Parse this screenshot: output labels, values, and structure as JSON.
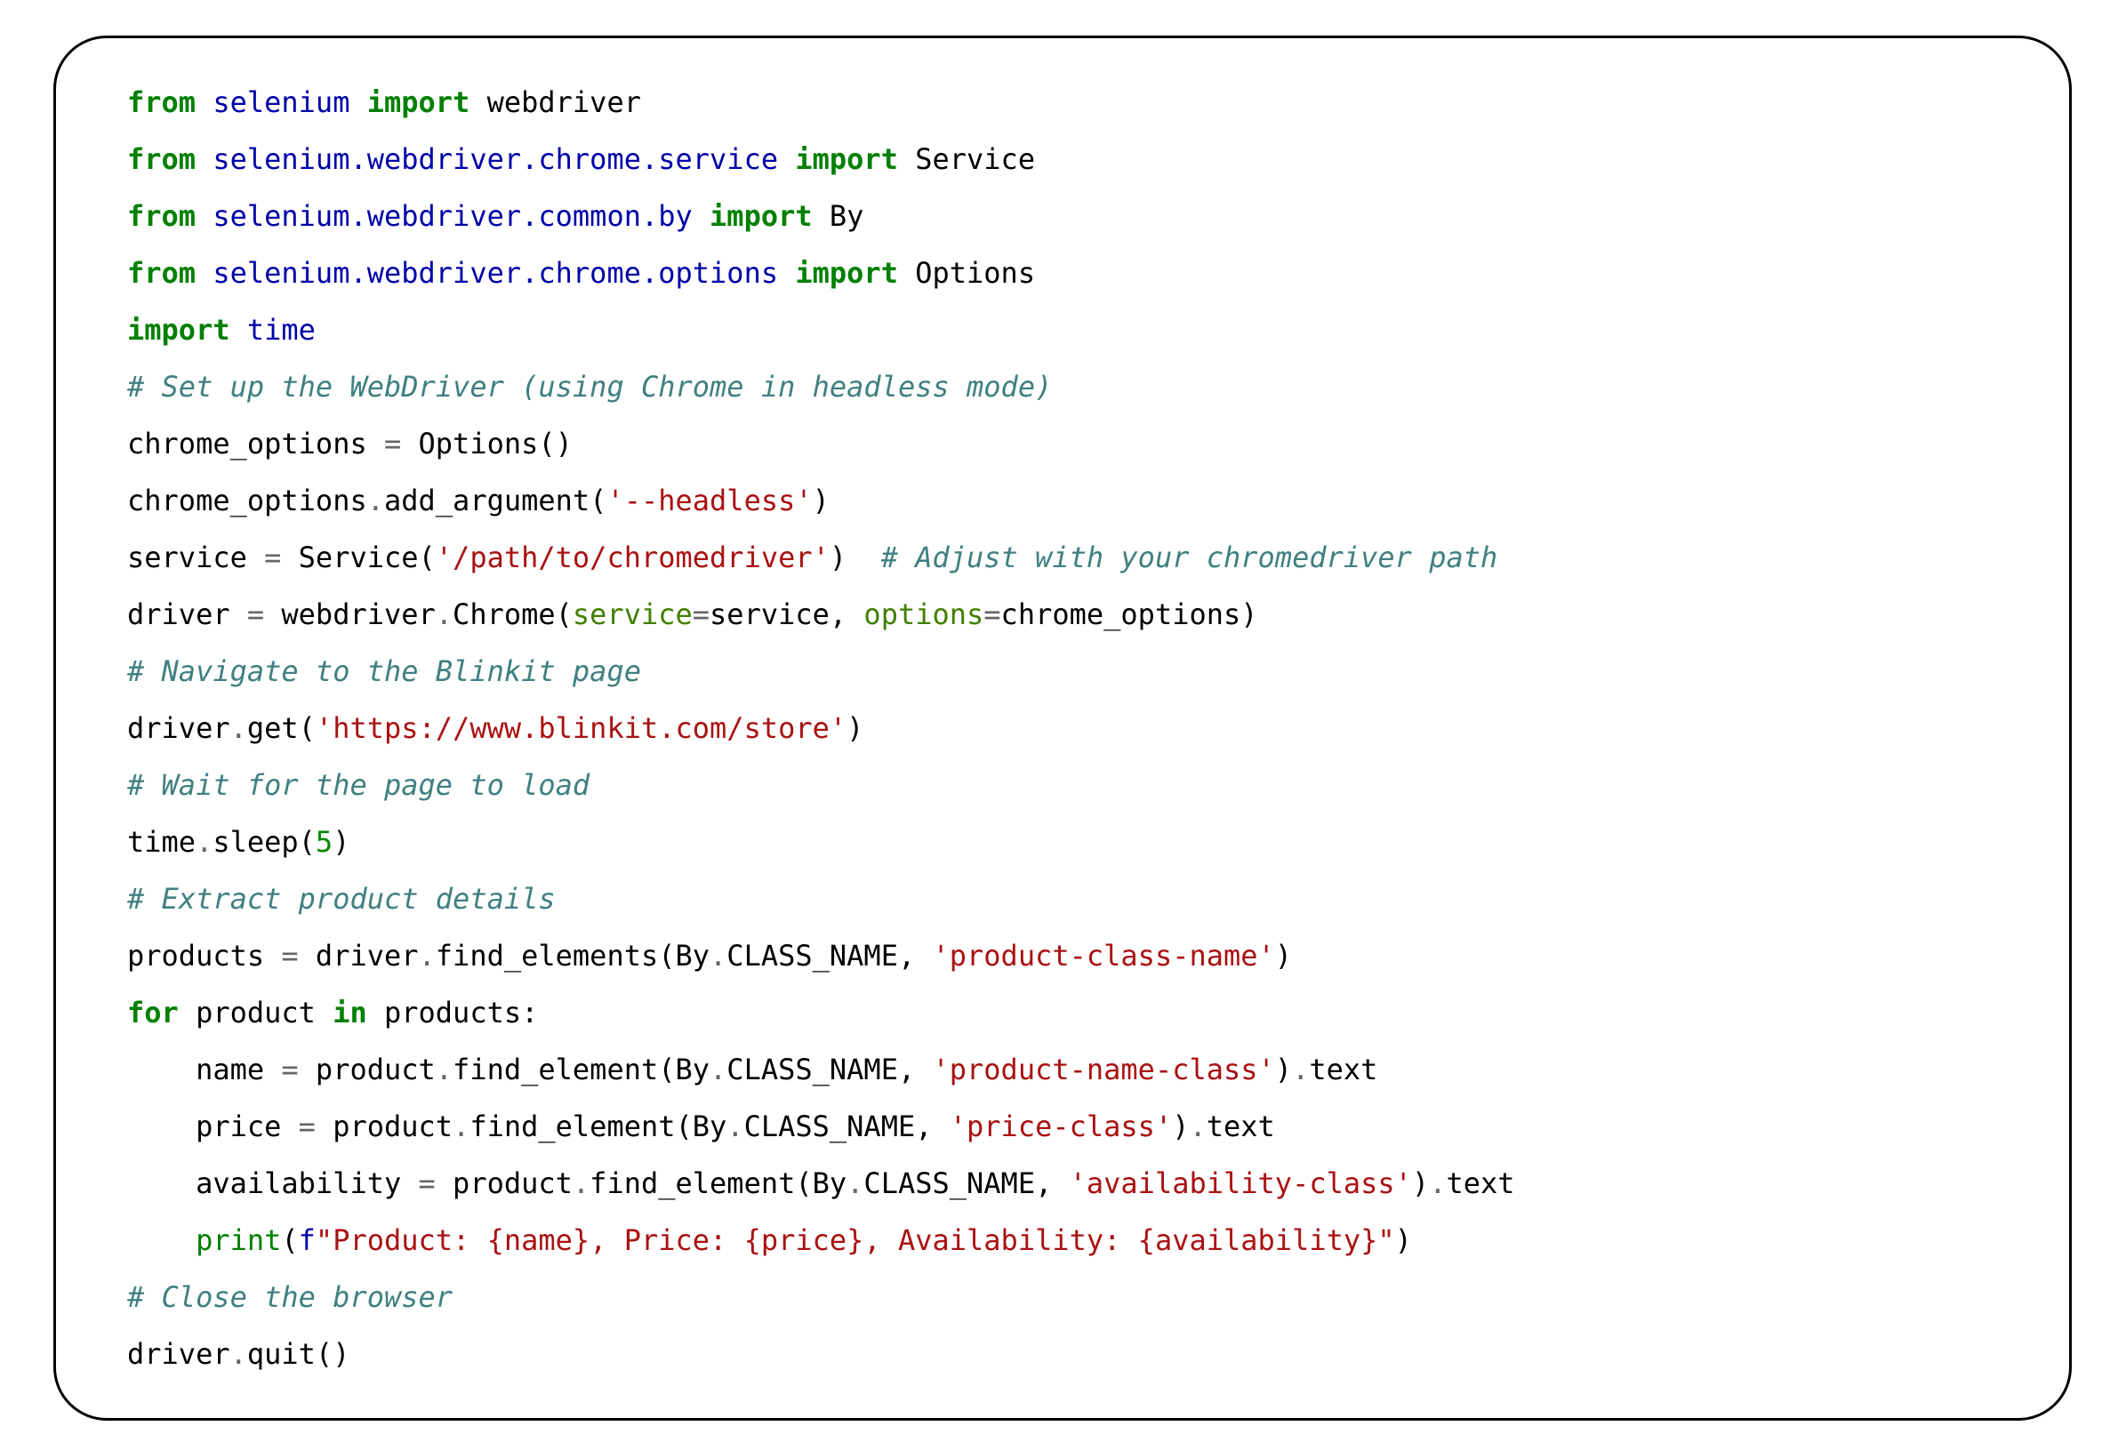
{
  "code": {
    "lines": [
      {
        "tokens": [
          {
            "t": "from",
            "c": "kw"
          },
          {
            "t": " ",
            "c": "plain"
          },
          {
            "t": "selenium",
            "c": "nn"
          },
          {
            "t": " ",
            "c": "plain"
          },
          {
            "t": "import",
            "c": "kw"
          },
          {
            "t": " ",
            "c": "plain"
          },
          {
            "t": "webdriver",
            "c": "plain"
          }
        ]
      },
      {
        "tokens": [
          {
            "t": "from",
            "c": "kw"
          },
          {
            "t": " ",
            "c": "plain"
          },
          {
            "t": "selenium.webdriver.chrome.service",
            "c": "nn"
          },
          {
            "t": " ",
            "c": "plain"
          },
          {
            "t": "import",
            "c": "kw"
          },
          {
            "t": " ",
            "c": "plain"
          },
          {
            "t": "Service",
            "c": "plain"
          }
        ]
      },
      {
        "tokens": [
          {
            "t": "from",
            "c": "kw"
          },
          {
            "t": " ",
            "c": "plain"
          },
          {
            "t": "selenium.webdriver.common.by",
            "c": "nn"
          },
          {
            "t": " ",
            "c": "plain"
          },
          {
            "t": "import",
            "c": "kw"
          },
          {
            "t": " ",
            "c": "plain"
          },
          {
            "t": "By",
            "c": "plain"
          }
        ]
      },
      {
        "tokens": [
          {
            "t": "from",
            "c": "kw"
          },
          {
            "t": " ",
            "c": "plain"
          },
          {
            "t": "selenium.webdriver.chrome.options",
            "c": "nn"
          },
          {
            "t": " ",
            "c": "plain"
          },
          {
            "t": "import",
            "c": "kw"
          },
          {
            "t": " ",
            "c": "plain"
          },
          {
            "t": "Options",
            "c": "plain"
          }
        ]
      },
      {
        "tokens": [
          {
            "t": "import",
            "c": "kw"
          },
          {
            "t": " ",
            "c": "plain"
          },
          {
            "t": "time",
            "c": "nn"
          }
        ]
      },
      {
        "tokens": [
          {
            "t": "# Set up the WebDriver (using Chrome in headless mode)",
            "c": "cm"
          }
        ]
      },
      {
        "tokens": [
          {
            "t": "chrome_options ",
            "c": "plain"
          },
          {
            "t": "=",
            "c": "op"
          },
          {
            "t": " Options()",
            "c": "plain"
          }
        ]
      },
      {
        "tokens": [
          {
            "t": "chrome_options",
            "c": "plain"
          },
          {
            "t": ".",
            "c": "op"
          },
          {
            "t": "add_argument(",
            "c": "plain"
          },
          {
            "t": "'--headless'",
            "c": "str"
          },
          {
            "t": ")",
            "c": "plain"
          }
        ]
      },
      {
        "tokens": [
          {
            "t": "service ",
            "c": "plain"
          },
          {
            "t": "=",
            "c": "op"
          },
          {
            "t": " Service(",
            "c": "plain"
          },
          {
            "t": "'/path/to/chromedriver'",
            "c": "str"
          },
          {
            "t": ")  ",
            "c": "plain"
          },
          {
            "t": "# Adjust with your chromedriver path",
            "c": "cm"
          }
        ]
      },
      {
        "tokens": [
          {
            "t": "driver ",
            "c": "plain"
          },
          {
            "t": "=",
            "c": "op"
          },
          {
            "t": " webdriver",
            "c": "plain"
          },
          {
            "t": ".",
            "c": "op"
          },
          {
            "t": "Chrome(",
            "c": "plain"
          },
          {
            "t": "service",
            "c": "na"
          },
          {
            "t": "=",
            "c": "op"
          },
          {
            "t": "service, ",
            "c": "plain"
          },
          {
            "t": "options",
            "c": "na"
          },
          {
            "t": "=",
            "c": "op"
          },
          {
            "t": "chrome_options)",
            "c": "plain"
          }
        ]
      },
      {
        "tokens": [
          {
            "t": "# Navigate to the Blinkit page",
            "c": "cm"
          }
        ]
      },
      {
        "tokens": [
          {
            "t": "driver",
            "c": "plain"
          },
          {
            "t": ".",
            "c": "op"
          },
          {
            "t": "get(",
            "c": "plain"
          },
          {
            "t": "'https://www.blinkit.com/store'",
            "c": "str"
          },
          {
            "t": ")",
            "c": "plain"
          }
        ]
      },
      {
        "tokens": [
          {
            "t": "# Wait for the page to load",
            "c": "cm"
          }
        ]
      },
      {
        "tokens": [
          {
            "t": "time",
            "c": "plain"
          },
          {
            "t": ".",
            "c": "op"
          },
          {
            "t": "sleep(",
            "c": "plain"
          },
          {
            "t": "5",
            "c": "num"
          },
          {
            "t": ")",
            "c": "plain"
          }
        ]
      },
      {
        "tokens": [
          {
            "t": "# Extract product details",
            "c": "cm"
          }
        ]
      },
      {
        "tokens": [
          {
            "t": "products ",
            "c": "plain"
          },
          {
            "t": "=",
            "c": "op"
          },
          {
            "t": " driver",
            "c": "plain"
          },
          {
            "t": ".",
            "c": "op"
          },
          {
            "t": "find_elements(By",
            "c": "plain"
          },
          {
            "t": ".",
            "c": "op"
          },
          {
            "t": "CLASS_NAME, ",
            "c": "plain"
          },
          {
            "t": "'product-class-name'",
            "c": "str"
          },
          {
            "t": ")",
            "c": "plain"
          }
        ]
      },
      {
        "tokens": [
          {
            "t": "for",
            "c": "kw"
          },
          {
            "t": " product ",
            "c": "plain"
          },
          {
            "t": "in",
            "c": "kw"
          },
          {
            "t": " products:",
            "c": "plain"
          }
        ]
      },
      {
        "tokens": [
          {
            "t": "    name ",
            "c": "plain"
          },
          {
            "t": "=",
            "c": "op"
          },
          {
            "t": " product",
            "c": "plain"
          },
          {
            "t": ".",
            "c": "op"
          },
          {
            "t": "find_element(By",
            "c": "plain"
          },
          {
            "t": ".",
            "c": "op"
          },
          {
            "t": "CLASS_NAME, ",
            "c": "plain"
          },
          {
            "t": "'product-name-class'",
            "c": "str"
          },
          {
            "t": ")",
            "c": "plain"
          },
          {
            "t": ".",
            "c": "op"
          },
          {
            "t": "text",
            "c": "plain"
          }
        ]
      },
      {
        "tokens": [
          {
            "t": "    price ",
            "c": "plain"
          },
          {
            "t": "=",
            "c": "op"
          },
          {
            "t": " product",
            "c": "plain"
          },
          {
            "t": ".",
            "c": "op"
          },
          {
            "t": "find_element(By",
            "c": "plain"
          },
          {
            "t": ".",
            "c": "op"
          },
          {
            "t": "CLASS_NAME, ",
            "c": "plain"
          },
          {
            "t": "'price-class'",
            "c": "str"
          },
          {
            "t": ")",
            "c": "plain"
          },
          {
            "t": ".",
            "c": "op"
          },
          {
            "t": "text",
            "c": "plain"
          }
        ]
      },
      {
        "tokens": [
          {
            "t": "    availability ",
            "c": "plain"
          },
          {
            "t": "=",
            "c": "op"
          },
          {
            "t": " product",
            "c": "plain"
          },
          {
            "t": ".",
            "c": "op"
          },
          {
            "t": "find_element(By",
            "c": "plain"
          },
          {
            "t": ".",
            "c": "op"
          },
          {
            "t": "CLASS_NAME, ",
            "c": "plain"
          },
          {
            "t": "'availability-class'",
            "c": "str"
          },
          {
            "t": ")",
            "c": "plain"
          },
          {
            "t": ".",
            "c": "op"
          },
          {
            "t": "text",
            "c": "plain"
          }
        ]
      },
      {
        "tokens": [
          {
            "t": "    ",
            "c": "plain"
          },
          {
            "t": "print",
            "c": "bi"
          },
          {
            "t": "(",
            "c": "plain"
          },
          {
            "t": "f",
            "c": "fpre"
          },
          {
            "t": "\"Product: ",
            "c": "fstr"
          },
          {
            "t": "{name}",
            "c": "fstr"
          },
          {
            "t": ", Price: ",
            "c": "fstr"
          },
          {
            "t": "{price}",
            "c": "fstr"
          },
          {
            "t": ", Availability: ",
            "c": "fstr"
          },
          {
            "t": "{availability}",
            "c": "fstr"
          },
          {
            "t": "\"",
            "c": "fstr"
          },
          {
            "t": ")",
            "c": "plain"
          }
        ]
      },
      {
        "tokens": [
          {
            "t": "# Close the browser",
            "c": "cm"
          }
        ]
      },
      {
        "tokens": [
          {
            "t": "driver",
            "c": "plain"
          },
          {
            "t": ".",
            "c": "op"
          },
          {
            "t": "quit()",
            "c": "plain"
          }
        ]
      }
    ]
  }
}
